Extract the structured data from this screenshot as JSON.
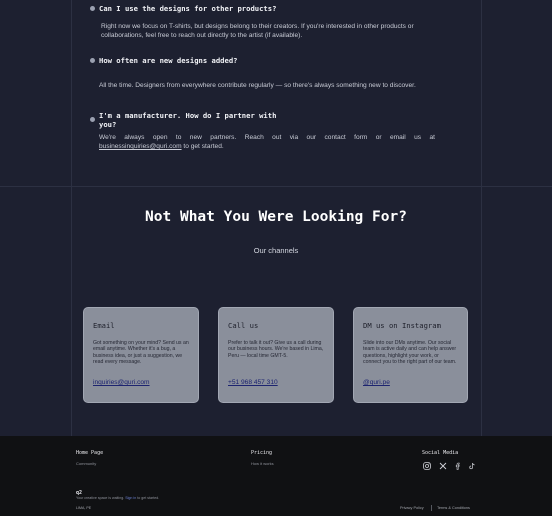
{
  "faq": [
    {
      "question_lines": [
        "Can I use the designs for other products?"
      ],
      "answer": "Right now we focus on T-shirts, but designs belong to their creators. If you're interested in other products or collaborations, feel free to reach out directly to the artist (if available)."
    },
    {
      "question_lines": [
        "How often are new designs added?"
      ],
      "answer": "All the time. Designers from everywhere contribute regularly — so there's always something new to discover."
    },
    {
      "question_lines": [
        "I'm a manufacturer. How do I partner with",
        "you?"
      ],
      "answer_lines": [
        "We're always open to new partners. Reach out via our contact form or email us at"
      ],
      "answer_link": "businessinquiries@quri.com",
      "answer_tail": " to get started."
    }
  ],
  "channels": {
    "title": "Not What You Were Looking For?",
    "subtitle": "Our channels",
    "cards": [
      {
        "title": "Email",
        "body": "Got something on your mind? Send us an email anytime. Whether it's a bug, a business idea, or just a suggestion, we read every message.",
        "link": "inquiries@quri.com"
      },
      {
        "title": "Call us",
        "body": "Prefer to talk it out? Give us a call during our business hours. We're based in Lima, Peru — local time GMT-5.",
        "link": "+51 968 457 310"
      },
      {
        "title": "DM us on Instagram",
        "body": "Slide into our DMs anytime. Our social team is active daily and can help answer questions, highlight your work, or connect you to the right part of our team.",
        "link": "@quri.pe"
      }
    ]
  },
  "footer": {
    "col1": {
      "heading": "Home Page",
      "link": "Community"
    },
    "col2": {
      "heading": "Pricing",
      "link": "How it works"
    },
    "social": {
      "heading": "Social Media",
      "icons": [
        "instagram-icon",
        "x-icon",
        "facebook-icon",
        "tiktok-icon"
      ]
    },
    "logo": "q2",
    "tagline_pre": "Your creative space is waiting. ",
    "tagline_link": "Sign in",
    "tagline_post": " to get started.",
    "location": "LIMA, PE",
    "privacy": "Privacy Policy",
    "terms": "Terms & Conditions"
  }
}
